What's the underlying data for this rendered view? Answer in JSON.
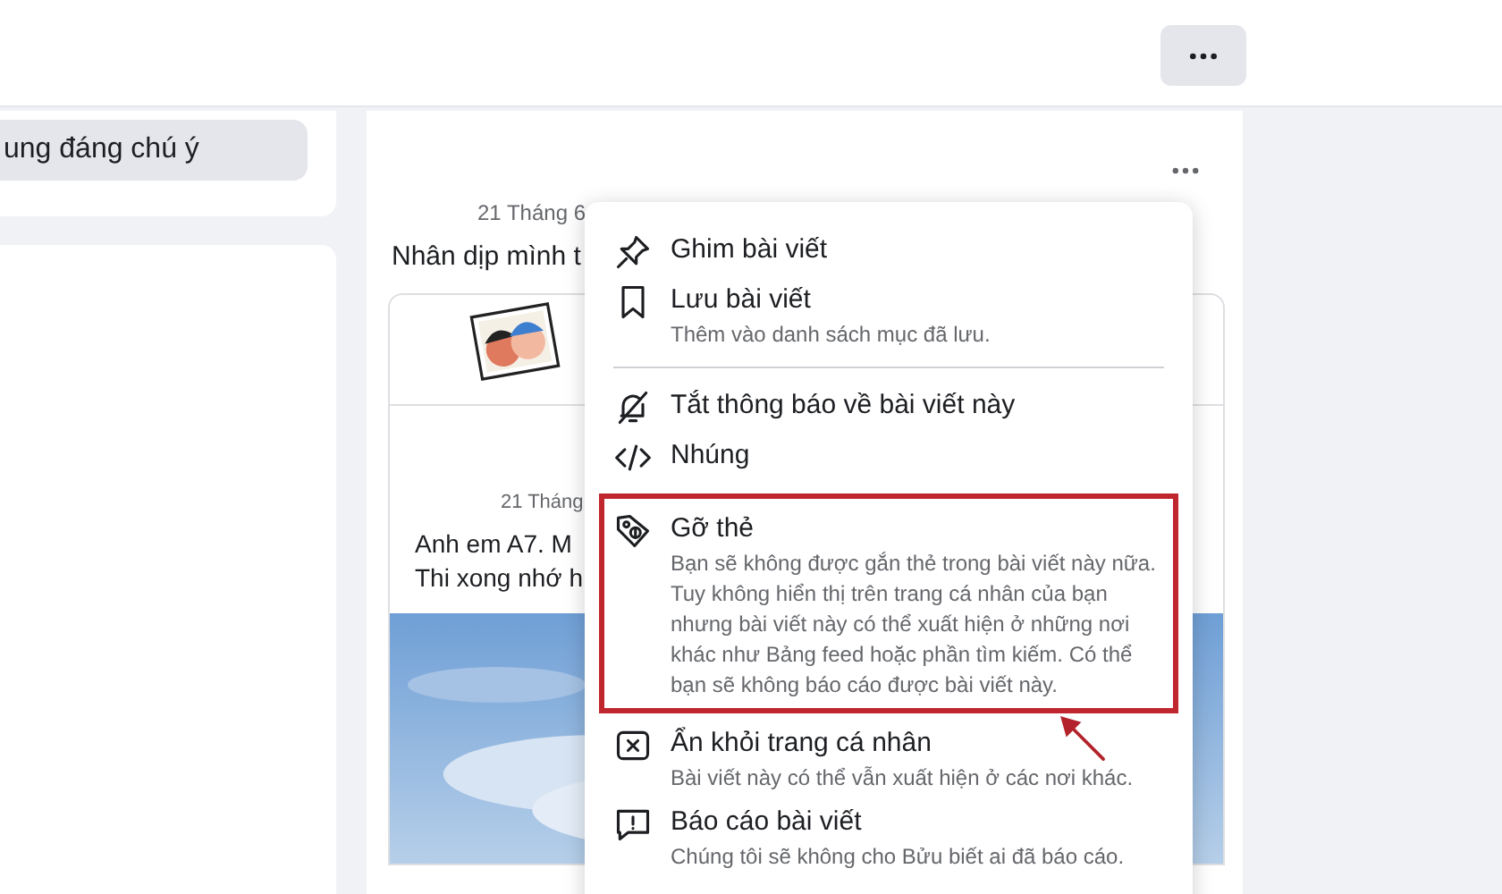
{
  "sidebar": {
    "selected_item": {
      "label": "ung đáng chú ý",
      "selected": true
    }
  },
  "post": {
    "date": "21 Tháng 6",
    "text": "Nhân dịp mình t",
    "shared": {
      "date": "21 Tháng",
      "lines": [
        "Anh em A7. M",
        "Thi xong nhớ h"
      ]
    }
  },
  "menu": {
    "items": [
      {
        "kind": "item",
        "title": "Ghim bài viết",
        "highlighted": false
      },
      {
        "kind": "item",
        "title": "Lưu bài viết",
        "description": "Thêm vào danh sách mục đã lưu.",
        "highlighted": false
      },
      {
        "kind": "divider"
      },
      {
        "kind": "item",
        "title": "Tắt thông báo về bài viết này",
        "highlighted": false
      },
      {
        "kind": "item",
        "title": "Nhúng",
        "highlighted": false
      },
      {
        "kind": "item",
        "title": "Gỡ thẻ",
        "description": "Bạn sẽ không được gắn thẻ trong bài viết này nữa. Tuy không hiển thị trên trang cá nhân của bạn nhưng bài viết này có thể xuất hiện ở những nơi khác như Bảng feed hoặc phần tìm kiếm. Có thể bạn sẽ không báo cáo được bài viết này.",
        "highlighted": true
      },
      {
        "kind": "item",
        "title": "Ẩn khỏi trang cá nhân",
        "description": "Bài viết này có thể vẫn xuất hiện ở các nơi khác.",
        "highlighted": false
      },
      {
        "kind": "item",
        "title": "Báo cáo bài viết",
        "description": "Chúng tôi sẽ không cho Bửu biết ai đã báo cáo.",
        "highlighted": false
      }
    ]
  }
}
